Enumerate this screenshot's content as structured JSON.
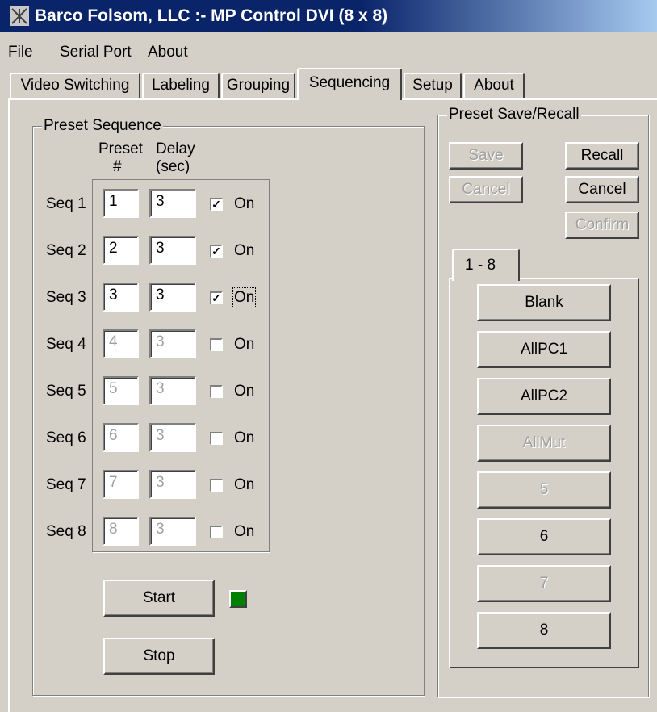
{
  "window": {
    "title": "Barco Folsom, LLC :- MP Control DVI (8 x 8)"
  },
  "menu": [
    "File",
    "Serial Port",
    "About"
  ],
  "tabs": [
    "Video Switching",
    "Labeling",
    "Grouping",
    "Sequencing",
    "Setup",
    "About"
  ],
  "active_tab": "Sequencing",
  "preset_sequence": {
    "title": "Preset Sequence",
    "col_preset": "Preset",
    "col_preset_sub": "#",
    "col_delay": "Delay",
    "col_delay_sub": "(sec)",
    "rows": [
      {
        "label": "Seq 1",
        "preset": "1",
        "delay": "3",
        "on_label": "On",
        "checked": true,
        "enabled": true
      },
      {
        "label": "Seq 2",
        "preset": "2",
        "delay": "3",
        "on_label": "On",
        "checked": true,
        "enabled": true
      },
      {
        "label": "Seq 3",
        "preset": "3",
        "delay": "3",
        "on_label": "On",
        "checked": true,
        "enabled": true
      },
      {
        "label": "Seq 4",
        "preset": "4",
        "delay": "3",
        "on_label": "On",
        "checked": false,
        "enabled": false
      },
      {
        "label": "Seq 5",
        "preset": "5",
        "delay": "3",
        "on_label": "On",
        "checked": false,
        "enabled": false
      },
      {
        "label": "Seq 6",
        "preset": "6",
        "delay": "3",
        "on_label": "On",
        "checked": false,
        "enabled": false
      },
      {
        "label": "Seq 7",
        "preset": "7",
        "delay": "3",
        "on_label": "On",
        "checked": false,
        "enabled": false
      },
      {
        "label": "Seq 8",
        "preset": "8",
        "delay": "3",
        "on_label": "On",
        "checked": false,
        "enabled": false
      }
    ],
    "start_label": "Start",
    "stop_label": "Stop",
    "indicator_color": "#008000"
  },
  "preset_save_recall": {
    "title": "Preset Save/Recall",
    "save_label": "Save",
    "cancel_left_label": "Cancel",
    "recall_label": "Recall",
    "cancel_right_label": "Cancel",
    "confirm_label": "Confirm",
    "tab_label": "1 - 8",
    "presets": [
      {
        "label": "Blank",
        "enabled": true
      },
      {
        "label": "AllPC1",
        "enabled": true
      },
      {
        "label": "AllPC2",
        "enabled": true
      },
      {
        "label": "AllMut",
        "enabled": false
      },
      {
        "label": "5",
        "enabled": false
      },
      {
        "label": "6",
        "enabled": true
      },
      {
        "label": "7",
        "enabled": false
      },
      {
        "label": "8",
        "enabled": true
      }
    ]
  },
  "colors": {
    "titlebar": "#0a246a",
    "face": "#d4d0c8",
    "indicator": "#008000"
  }
}
